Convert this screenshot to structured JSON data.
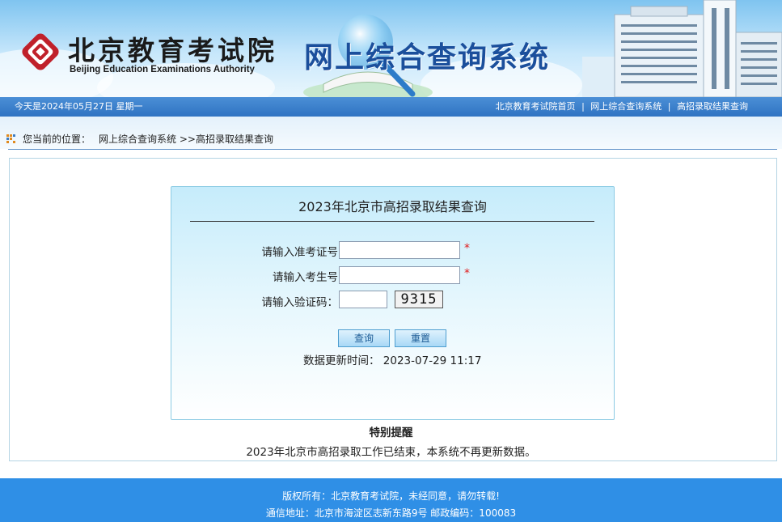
{
  "header": {
    "logo_cn": "北京教育考试院",
    "logo_en": "Beijing Education Examinations Authority",
    "system_title": "网上综合查询系统"
  },
  "navbar": {
    "today": "今天是2024年05月27日  星期一",
    "links": [
      "北京教育考试院首页",
      "网上综合查询系统",
      "高招录取结果查询"
    ],
    "separator": "|"
  },
  "breadcrumb": {
    "prefix": "您当前的位置：",
    "system": "网上综合查询系统",
    "current": ">>高招录取结果查询"
  },
  "form": {
    "title": "2023年北京市高招录取结果查询",
    "exam_no_label": "请输入准考证号",
    "exam_no_value": "",
    "student_no_label": "请输入考生号",
    "student_no_value": "",
    "captcha_label": "请输入验证码：",
    "captcha_value": "",
    "captcha_image_text": "9315",
    "required_mark": "*",
    "query_button": "查询",
    "reset_button": "重置",
    "updated_text": "数据更新时间：  2023-07-29 11:17"
  },
  "notice": {
    "title": "特别提醒",
    "body": "2023年北京市高招录取工作已结束，本系统不再更新数据。"
  },
  "footer": {
    "copyright": "版权所有：北京教育考试院，未经同意，请勿转载!",
    "address": "通信地址：北京市海淀区志新东路9号 邮政编码：100083"
  },
  "colors": {
    "nav_blue": "#2f73c2",
    "footer_blue": "#2f8fe6",
    "title_blue": "#1b4f9c",
    "logo_red": "#c0202a",
    "required_red": "#e01b1b"
  }
}
